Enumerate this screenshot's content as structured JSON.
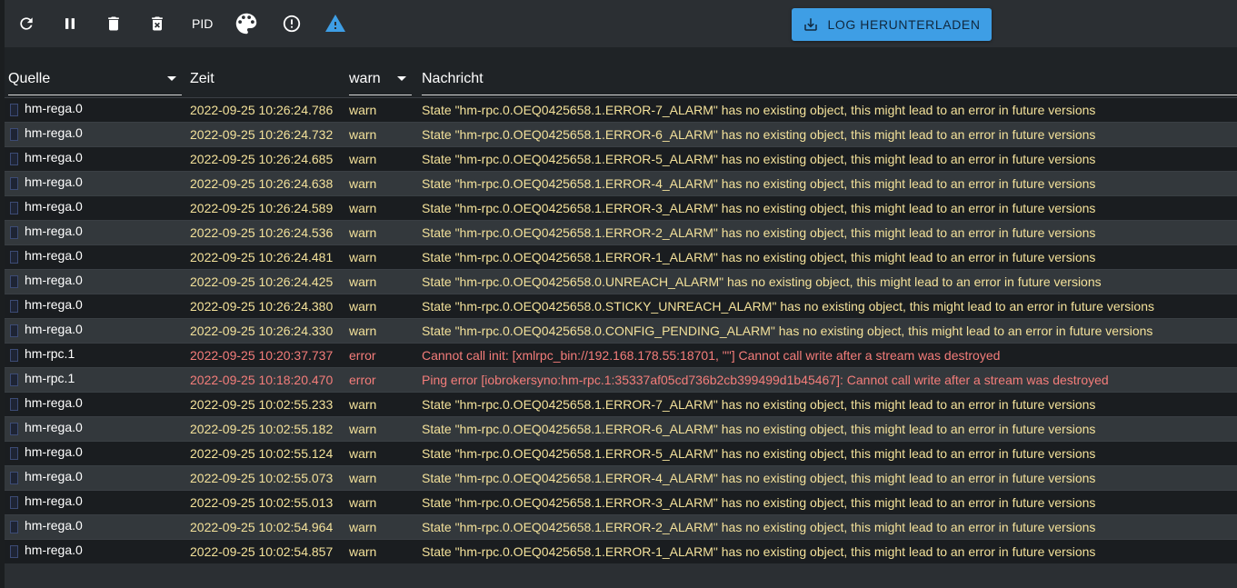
{
  "toolbar": {
    "buttons": [
      {
        "icon": "refresh-icon"
      },
      {
        "icon": "pause-icon"
      },
      {
        "icon": "delete-icon"
      },
      {
        "icon": "delete-forever-icon"
      },
      {
        "icon": "palette-icon"
      },
      {
        "icon": "alert-circle-icon"
      },
      {
        "icon": "warning-triangle-icon"
      }
    ],
    "pid_label": "PID",
    "download_label": "LOG HERUNTERLADEN",
    "download_icon": "download-icon",
    "accent_color": "#3e9ee5"
  },
  "table": {
    "headers": {
      "source": "Quelle",
      "time": "Zeit",
      "level": "warn",
      "message": "Nachricht"
    },
    "colors": {
      "warn": "#f3e19a",
      "error": "#f47d7a"
    },
    "rows": [
      {
        "source": "hm-rega.0",
        "time": "2022-09-25 10:26:24.786",
        "level": "warn",
        "message": "State \"hm-rpc.0.OEQ0425658.1.ERROR-7_ALARM\" has no existing object, this might lead to an error in future versions"
      },
      {
        "source": "hm-rega.0",
        "time": "2022-09-25 10:26:24.732",
        "level": "warn",
        "message": "State \"hm-rpc.0.OEQ0425658.1.ERROR-6_ALARM\" has no existing object, this might lead to an error in future versions"
      },
      {
        "source": "hm-rega.0",
        "time": "2022-09-25 10:26:24.685",
        "level": "warn",
        "message": "State \"hm-rpc.0.OEQ0425658.1.ERROR-5_ALARM\" has no existing object, this might lead to an error in future versions"
      },
      {
        "source": "hm-rega.0",
        "time": "2022-09-25 10:26:24.638",
        "level": "warn",
        "message": "State \"hm-rpc.0.OEQ0425658.1.ERROR-4_ALARM\" has no existing object, this might lead to an error in future versions"
      },
      {
        "source": "hm-rega.0",
        "time": "2022-09-25 10:26:24.589",
        "level": "warn",
        "message": "State \"hm-rpc.0.OEQ0425658.1.ERROR-3_ALARM\" has no existing object, this might lead to an error in future versions"
      },
      {
        "source": "hm-rega.0",
        "time": "2022-09-25 10:26:24.536",
        "level": "warn",
        "message": "State \"hm-rpc.0.OEQ0425658.1.ERROR-2_ALARM\" has no existing object, this might lead to an error in future versions"
      },
      {
        "source": "hm-rega.0",
        "time": "2022-09-25 10:26:24.481",
        "level": "warn",
        "message": "State \"hm-rpc.0.OEQ0425658.1.ERROR-1_ALARM\" has no existing object, this might lead to an error in future versions"
      },
      {
        "source": "hm-rega.0",
        "time": "2022-09-25 10:26:24.425",
        "level": "warn",
        "message": "State \"hm-rpc.0.OEQ0425658.0.UNREACH_ALARM\" has no existing object, this might lead to an error in future versions"
      },
      {
        "source": "hm-rega.0",
        "time": "2022-09-25 10:26:24.380",
        "level": "warn",
        "message": "State \"hm-rpc.0.OEQ0425658.0.STICKY_UNREACH_ALARM\" has no existing object, this might lead to an error in future versions"
      },
      {
        "source": "hm-rega.0",
        "time": "2022-09-25 10:26:24.330",
        "level": "warn",
        "message": "State \"hm-rpc.0.OEQ0425658.0.CONFIG_PENDING_ALARM\" has no existing object, this might lead to an error in future versions"
      },
      {
        "source": "hm-rpc.1",
        "time": "2022-09-25 10:20:37.737",
        "level": "error",
        "message": "Cannot call init: [xmlrpc_bin://192.168.178.55:18701, \"\"] Cannot call write after a stream was destroyed"
      },
      {
        "source": "hm-rpc.1",
        "time": "2022-09-25 10:18:20.470",
        "level": "error",
        "message": "Ping error [iobrokersyno:hm-rpc.1:35337af05cd736b2cb399499d1b45467]: Cannot call write after a stream was destroyed"
      },
      {
        "source": "hm-rega.0",
        "time": "2022-09-25 10:02:55.233",
        "level": "warn",
        "message": "State \"hm-rpc.0.OEQ0425658.1.ERROR-7_ALARM\" has no existing object, this might lead to an error in future versions"
      },
      {
        "source": "hm-rega.0",
        "time": "2022-09-25 10:02:55.182",
        "level": "warn",
        "message": "State \"hm-rpc.0.OEQ0425658.1.ERROR-6_ALARM\" has no existing object, this might lead to an error in future versions"
      },
      {
        "source": "hm-rega.0",
        "time": "2022-09-25 10:02:55.124",
        "level": "warn",
        "message": "State \"hm-rpc.0.OEQ0425658.1.ERROR-5_ALARM\" has no existing object, this might lead to an error in future versions"
      },
      {
        "source": "hm-rega.0",
        "time": "2022-09-25 10:02:55.073",
        "level": "warn",
        "message": "State \"hm-rpc.0.OEQ0425658.1.ERROR-4_ALARM\" has no existing object, this might lead to an error in future versions"
      },
      {
        "source": "hm-rega.0",
        "time": "2022-09-25 10:02:55.013",
        "level": "warn",
        "message": "State \"hm-rpc.0.OEQ0425658.1.ERROR-3_ALARM\" has no existing object, this might lead to an error in future versions"
      },
      {
        "source": "hm-rega.0",
        "time": "2022-09-25 10:02:54.964",
        "level": "warn",
        "message": "State \"hm-rpc.0.OEQ0425658.1.ERROR-2_ALARM\" has no existing object, this might lead to an error in future versions"
      },
      {
        "source": "hm-rega.0",
        "time": "2022-09-25 10:02:54.857",
        "level": "warn",
        "message": "State \"hm-rpc.0.OEQ0425658.1.ERROR-1_ALARM\" has no existing object, this might lead to an error in future versions"
      }
    ]
  }
}
